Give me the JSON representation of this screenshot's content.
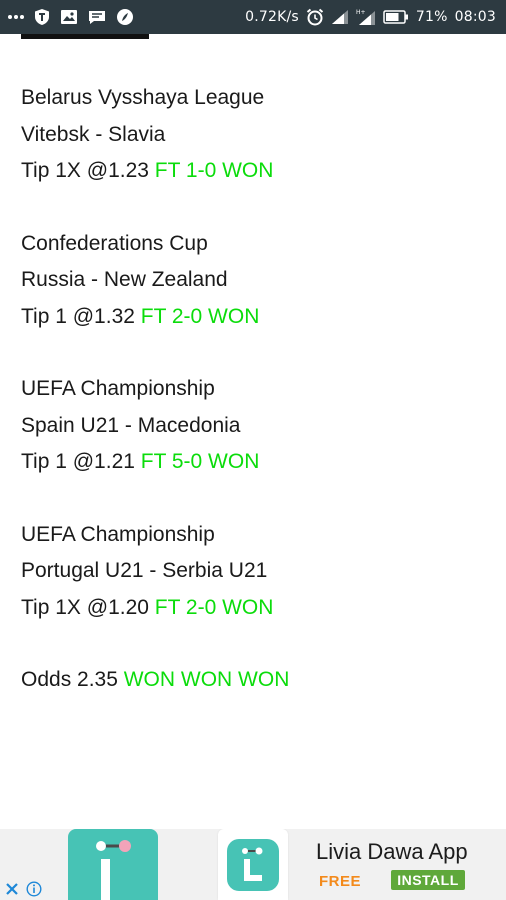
{
  "status_bar": {
    "network_speed": "0.72K/s",
    "battery_percent": "71%",
    "time": "08:03",
    "icons": [
      "more-dots-icon",
      "shield-app-icon",
      "image-icon",
      "message-icon",
      "browser-icon",
      "alarm-icon",
      "signal-icon",
      "signal-hplus-icon",
      "battery-icon"
    ]
  },
  "tips": [
    {
      "league": "Belarus Vysshaya League",
      "match": "Vitebsk - Slavia",
      "tip": "Tip 1X @1.23 ",
      "result": "FT 1-0 WON"
    },
    {
      "league": "Confederations Cup",
      "match": "Russia - New Zealand",
      "tip": "Tip 1 @1.32 ",
      "result": "FT 2-0 WON"
    },
    {
      "league": "UEFA Championship",
      "match": "Spain U21 - Macedonia",
      "tip": "Tip 1 @1.21 ",
      "result": "FT 5-0 WON"
    },
    {
      "league": "UEFA Championship",
      "match": "Portugal U21 - Serbia U21",
      "tip": "Tip 1X @1.20 ",
      "result": "FT 2-0 WON"
    }
  ],
  "summary": {
    "odds": "Odds 2.35 ",
    "result": "WON WON WON"
  },
  "ad": {
    "app_name": "Livia Dawa App",
    "price": "FREE",
    "install_label": "INSTALL",
    "brand_color": "#47c3b5",
    "install_color": "#5fa83a",
    "free_color": "#f38a1c"
  },
  "colors": {
    "won_text": "#0bdc0b",
    "status_bar_bg": "#2d3a41"
  }
}
